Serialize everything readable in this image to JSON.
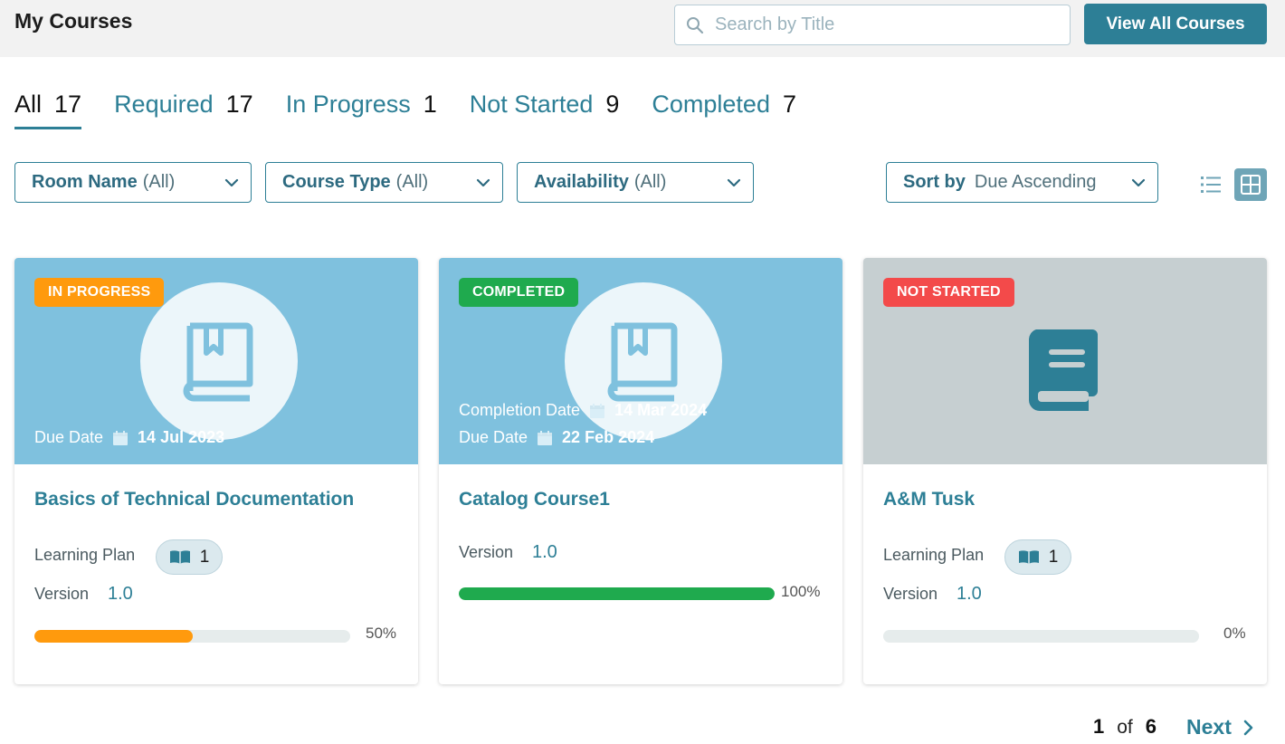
{
  "header": {
    "title": "My Courses",
    "search_placeholder": "Search by Title",
    "view_all_label": "View All Courses"
  },
  "tabs": [
    {
      "label": "All",
      "count": "17",
      "active": true
    },
    {
      "label": "Required",
      "count": "17"
    },
    {
      "label": "In Progress",
      "count": "1"
    },
    {
      "label": "Not Started",
      "count": "9"
    },
    {
      "label": "Completed",
      "count": "7"
    }
  ],
  "filters": {
    "room": {
      "label": "Room Name",
      "value": "(All)"
    },
    "course_type": {
      "label": "Course Type",
      "value": "(All)"
    },
    "availability": {
      "label": "Availability",
      "value": "(All)"
    },
    "sort": {
      "label": "Sort by",
      "value": "Due Ascending"
    }
  },
  "view_toggle": {
    "list_icon": "list-icon",
    "grid_icon": "grid-icon",
    "selected": "grid"
  },
  "colors": {
    "accent": "#2d7f96",
    "in_progress": "#ff9a0d",
    "completed": "#1faa4e",
    "not_started": "#f34a4a",
    "hero_blue": "#7fc1de",
    "hero_gray": "#c6cfd1"
  },
  "cards": [
    {
      "status": "IN PROGRESS",
      "due_label": "Due Date",
      "due_date": "14 Jul 2023",
      "title": "Basics of Technical Documentation",
      "learning_plan_label": "Learning Plan",
      "learning_plan_count": "1",
      "version_label": "Version",
      "version": "1.0",
      "progress": 50,
      "progress_label": "50%"
    },
    {
      "status": "COMPLETED",
      "completion_label": "Completion Date",
      "completion_date": "14 Mar 2024",
      "due_label": "Due Date",
      "due_date": "22 Feb 2024",
      "title": "Catalog Course1",
      "version_label": "Version",
      "version": "1.0",
      "progress": 100,
      "progress_label": "100%"
    },
    {
      "status": "NOT STARTED",
      "title": "A&M Tusk",
      "learning_plan_label": "Learning Plan",
      "learning_plan_count": "1",
      "version_label": "Version",
      "version": "1.0",
      "progress": 0,
      "progress_label": "0%"
    }
  ],
  "pagination": {
    "current": "1",
    "of_label": "of",
    "total": "6",
    "next_label": "Next"
  }
}
